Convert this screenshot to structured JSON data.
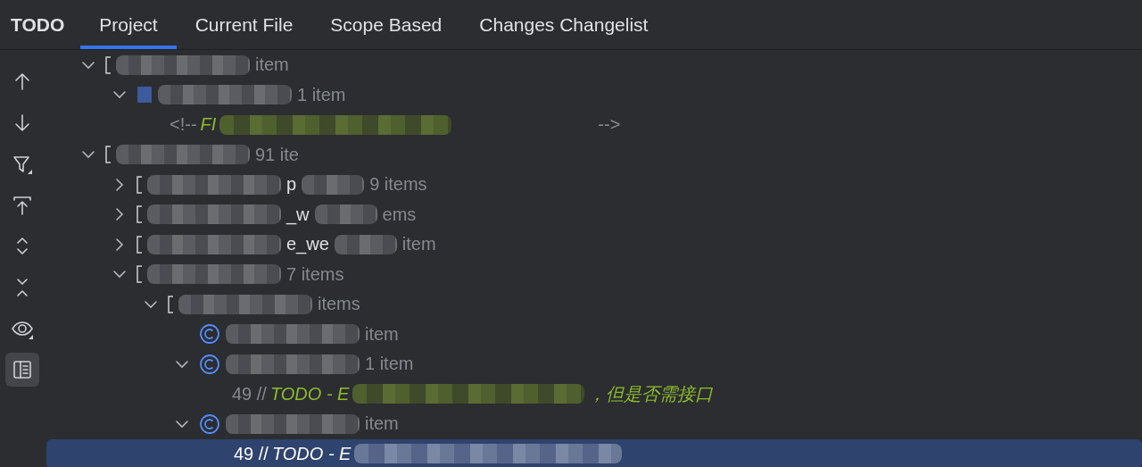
{
  "title": "TODO",
  "tabs": [
    {
      "label": "Project",
      "selected": true
    },
    {
      "label": "Current File",
      "selected": false
    },
    {
      "label": "Scope Based",
      "selected": false
    },
    {
      "label": "Changes Changelist",
      "selected": false
    }
  ],
  "toolbar": [
    {
      "kind": "up",
      "selected": false
    },
    {
      "kind": "down",
      "selected": false
    },
    {
      "kind": "filter",
      "selected": false
    },
    {
      "kind": "scroll-top",
      "selected": false
    },
    {
      "kind": "expand",
      "selected": false
    },
    {
      "kind": "collapse",
      "selected": false
    },
    {
      "kind": "eye",
      "selected": false
    },
    {
      "kind": "preview",
      "selected": true
    }
  ],
  "tree": [
    {
      "kind": "module",
      "count": "item",
      "expanded": true,
      "children": [
        {
          "kind": "file",
          "count": "1 item",
          "expanded": true,
          "children": [
            {
              "kind": "todo",
              "prefix": "<!--",
              "tag": "FI",
              "suffix": "-->",
              "selected": false
            }
          ]
        }
      ]
    },
    {
      "kind": "module",
      "count": "91 ite",
      "expanded": true,
      "children": [
        {
          "kind": "folder",
          "name": "p",
          "count": "9 items",
          "expanded": false
        },
        {
          "kind": "folder",
          "name": "_w",
          "count": "ems",
          "expanded": false
        },
        {
          "kind": "folder",
          "name": "e_we",
          "count": "item",
          "expanded": false
        },
        {
          "kind": "folder",
          "count": "7 items",
          "expanded": true,
          "children": [
            {
              "kind": "folder",
              "count": "items",
              "expanded": true,
              "children": [
                {
                  "kind": "class",
                  "count": "item"
                },
                {
                  "kind": "class",
                  "count": "1 item",
                  "expanded": true,
                  "children": [
                    {
                      "kind": "todo",
                      "prefix": "49 //",
                      "tag": "TODO - E",
                      "suffix": "，但是否需接口",
                      "selected": false
                    }
                  ]
                },
                {
                  "kind": "class",
                  "count": "item",
                  "expanded": true,
                  "children": [
                    {
                      "kind": "todo",
                      "prefix": "49 //",
                      "tag": "TODO - E",
                      "selected": true
                    }
                  ]
                }
              ]
            }
          ]
        }
      ]
    }
  ]
}
